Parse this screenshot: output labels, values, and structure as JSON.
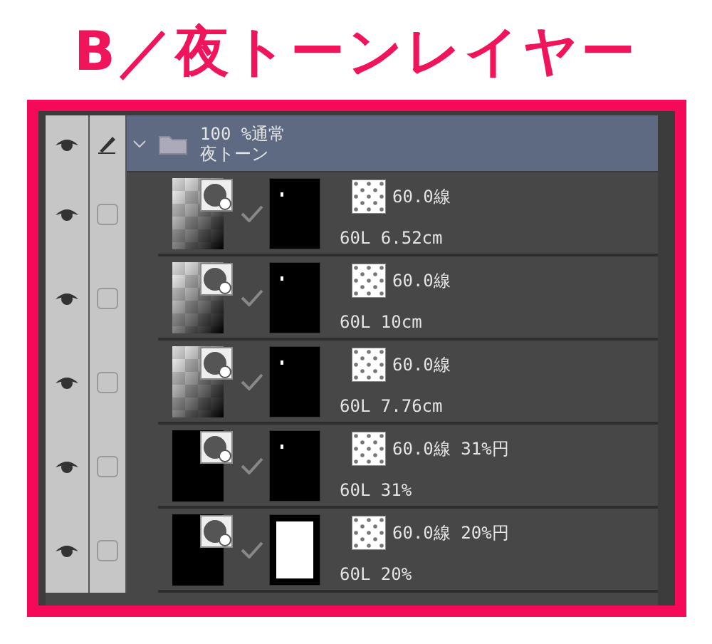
{
  "heading": "B／夜トーンレイヤー",
  "folder": {
    "visible": true,
    "editing": true,
    "expanded": true,
    "blend": "100 %通常",
    "name": "夜トーン"
  },
  "layers": [
    {
      "visible": true,
      "checked": false,
      "thumbnail": {
        "kind": "gradient"
      },
      "mask": {
        "kind": "dark"
      },
      "tone": "60.0線",
      "info": "60L 6.52cm"
    },
    {
      "visible": true,
      "checked": false,
      "thumbnail": {
        "kind": "gradient"
      },
      "mask": {
        "kind": "dark"
      },
      "tone": "60.0線",
      "info": "60L 10cm"
    },
    {
      "visible": true,
      "checked": false,
      "thumbnail": {
        "kind": "gradient"
      },
      "mask": {
        "kind": "dark"
      },
      "tone": "60.0線",
      "info": "60L 7.76cm"
    },
    {
      "visible": true,
      "checked": false,
      "thumbnail": {
        "kind": "black"
      },
      "mask": {
        "kind": "dark"
      },
      "tone": "60.0線 31%円",
      "info": "60L 31%"
    },
    {
      "visible": true,
      "checked": false,
      "thumbnail": {
        "kind": "black"
      },
      "mask": {
        "kind": "white"
      },
      "tone": "60.0線 20%円",
      "info": "60L 20%"
    }
  ]
}
